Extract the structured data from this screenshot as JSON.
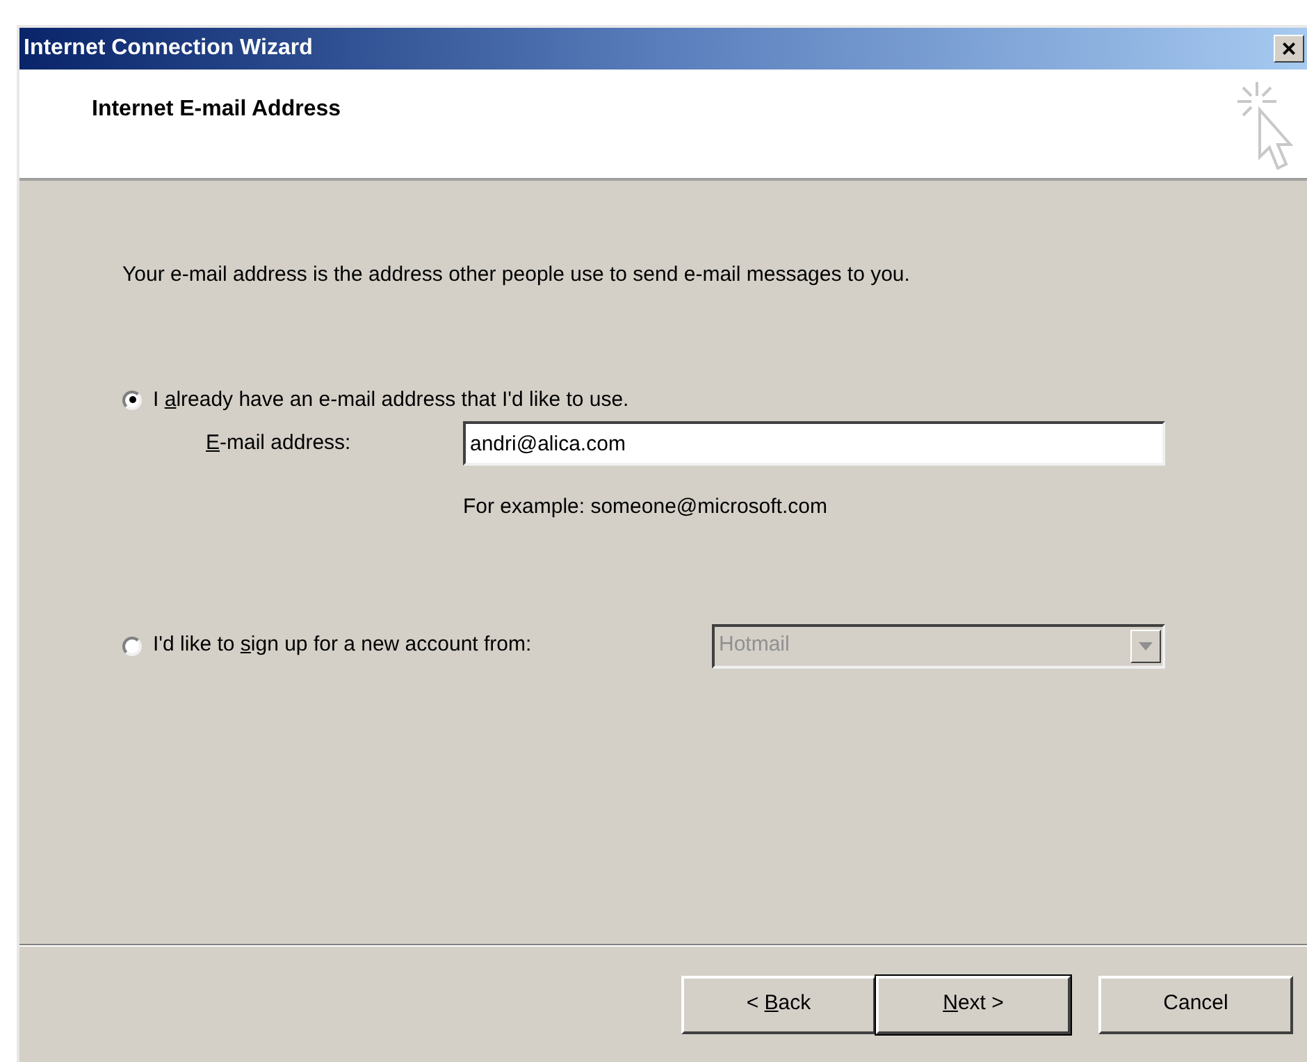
{
  "window": {
    "title": "Internet Connection Wizard",
    "close_glyph": "×"
  },
  "header": {
    "title": "Internet E-mail Address"
  },
  "intro": "Your e-mail address is the address other people use to send e-mail messages to you.",
  "options": [
    {
      "kind": "field",
      "label_start": "I ",
      "access_key": "a",
      "label_end": "lready have an e-mail address that I'd like to use.",
      "selected": true,
      "field_access_key": "E",
      "field_label_end": "-mail address:",
      "value": "andri@alica.com",
      "hint": "For example: someone@microsoft.com"
    },
    {
      "kind": "dropdown",
      "label_start": "I'd like to ",
      "access_key": "s",
      "label_end": "ign up for a new account from:",
      "selected": false,
      "value": "Hotmail",
      "disabled": true
    }
  ],
  "buttons": [
    {
      "label_start": "< ",
      "access_key": "B",
      "label_end": "ack",
      "default": false
    },
    {
      "access_key": "N",
      "label_end": "ext >",
      "default": true
    },
    {
      "label_start": "Cancel",
      "default": false
    }
  ]
}
